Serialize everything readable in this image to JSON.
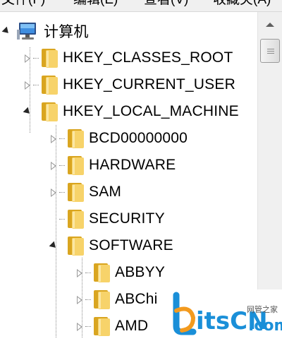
{
  "menubar": {
    "items": [
      "文件(F)",
      "编辑(E)",
      "查看(V)",
      "收藏夹(A)"
    ]
  },
  "tree": {
    "root": "计算机",
    "hkcr": "HKEY_CLASSES_ROOT",
    "hkcu": "HKEY_CURRENT_USER",
    "hklm": "HKEY_LOCAL_MACHINE",
    "bcd": "BCD00000000",
    "hardware": "HARDWARE",
    "sam": "SAM",
    "security": "SECURITY",
    "software": "SOFTWARE",
    "abbyy": "ABBYY",
    "abchina": "ABChi",
    "amd": "AMD"
  },
  "watermark": {
    "brand": "itsCN",
    "suffix": ".com",
    "site": "网管之家",
    "brand_color": "#1a8fd8",
    "accent_color": "#f39a1e"
  }
}
